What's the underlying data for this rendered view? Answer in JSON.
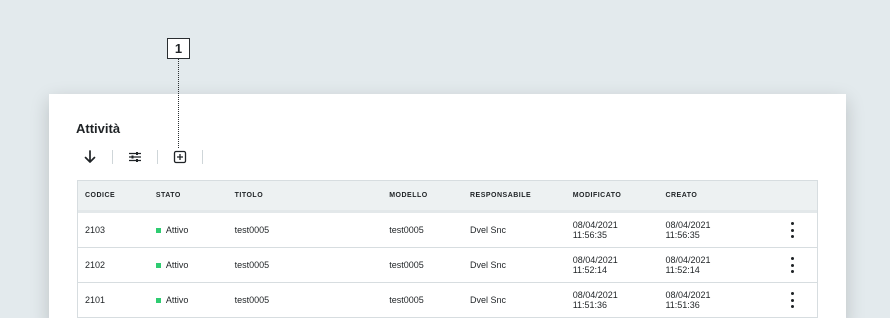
{
  "callout": {
    "number": "1"
  },
  "panel": {
    "title": "Attività"
  },
  "toolbar": {
    "icons": [
      "arrow-down-icon",
      "sliders-icon",
      "plus-square-icon"
    ]
  },
  "table": {
    "headers": [
      "CODICE",
      "STATO",
      "TITOLO",
      "MODELLO",
      "RESPONSABILE",
      "MODIFICATO",
      "CREATO"
    ],
    "rows": [
      {
        "codice": "2103",
        "stato": "Attivo",
        "titolo": "test0005",
        "modello": "test0005",
        "responsabile": "Dvel Snc",
        "modificato_date": "08/04/2021",
        "modificato_time": "11:56:35",
        "creato_date": "08/04/2021",
        "creato_time": "11:56:35"
      },
      {
        "codice": "2102",
        "stato": "Attivo",
        "titolo": "test0005",
        "modello": "test0005",
        "responsabile": "Dvel Snc",
        "modificato_date": "08/04/2021",
        "modificato_time": "11:52:14",
        "creato_date": "08/04/2021",
        "creato_time": "11:52:14"
      },
      {
        "codice": "2101",
        "stato": "Attivo",
        "titolo": "test0005",
        "modello": "test0005",
        "responsabile": "Dvel Snc",
        "modificato_date": "08/04/2021",
        "modificato_time": "11:51:36",
        "creato_date": "08/04/2021",
        "creato_time": "11:51:36"
      }
    ],
    "status_color": "#2ecc71"
  }
}
